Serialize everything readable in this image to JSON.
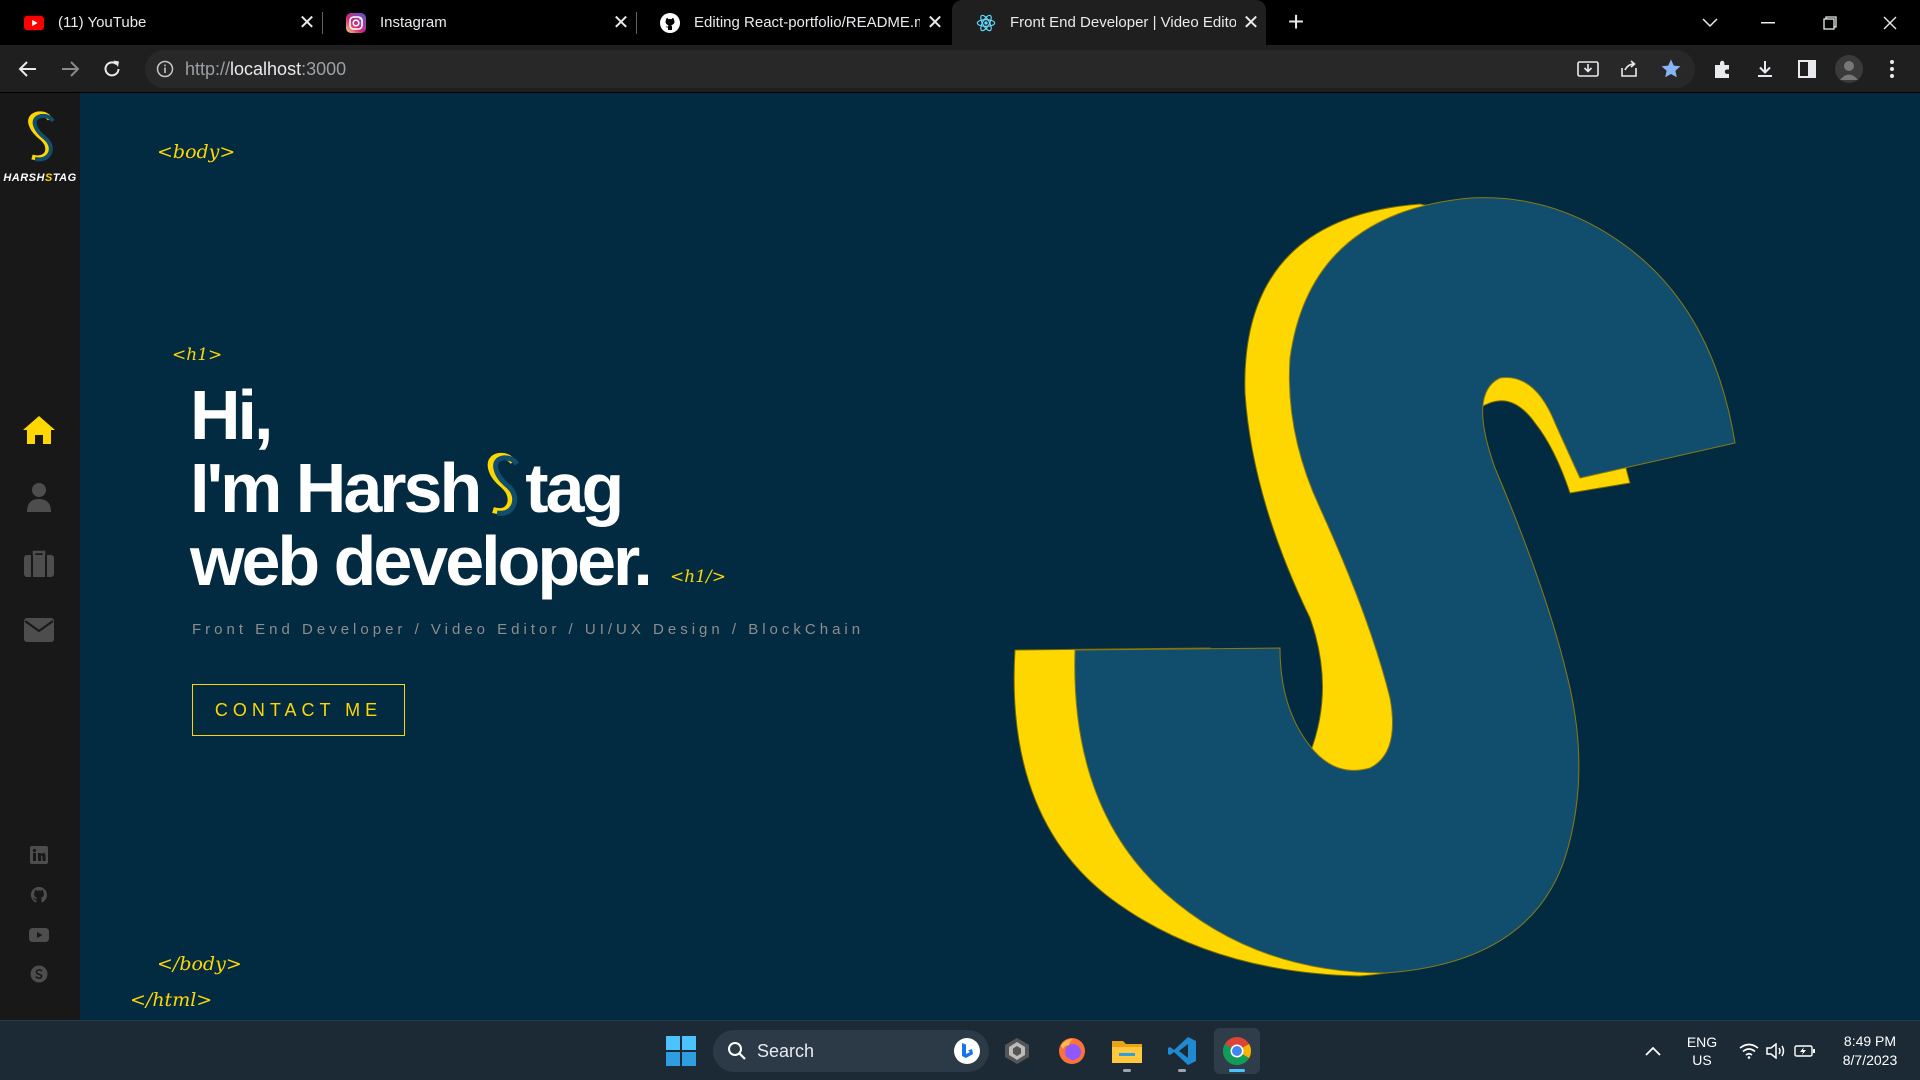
{
  "browser": {
    "tabs": [
      {
        "label": "(11) YouTube",
        "icon": "youtube-icon",
        "active": false
      },
      {
        "label": "Instagram",
        "icon": "instagram-icon",
        "active": false
      },
      {
        "label": "Editing React-portfolio/README.md",
        "icon": "github-icon",
        "active": false
      },
      {
        "label": "Front End Developer | Video Editor |",
        "icon": "react-icon",
        "active": true
      }
    ],
    "new_tab": "+",
    "url_host": "localhost",
    "url_prefix": "http://",
    "url_port": ":3000"
  },
  "sidebar": {
    "logo_text_a": "HARSH",
    "logo_text_b": "S",
    "logo_text_c": "TAG",
    "nav": [
      "home-icon",
      "user-icon",
      "briefcase-icon",
      "envelope-icon"
    ],
    "social": [
      "linkedin-icon",
      "github-icon",
      "youtube-icon",
      "skype-icon"
    ]
  },
  "page": {
    "tag_body_open": "<body>",
    "tag_h1_open": "<h1>",
    "tag_h1_close": "<h1/>",
    "tag_body_close": "</body>",
    "tag_html_close": "</html>",
    "hero_line1": "Hi,",
    "hero_line2_a": "I'm Harsh",
    "hero_line2_b": "tag",
    "hero_line3": "web developer.",
    "subtitle": "Front End Developer / Video Editor / UI/UX Design / BlockChain",
    "contact_button": "CONTACT ME"
  },
  "taskbar": {
    "search_label": "Search",
    "lang_1": "ENG",
    "lang_2": "US",
    "time": "8:49 PM",
    "date": "8/7/2023"
  },
  "colors": {
    "accent": "#ffd700",
    "page_bg": "#022b42",
    "s_blue": "#114e6e",
    "sidebar_bg": "#181818"
  }
}
